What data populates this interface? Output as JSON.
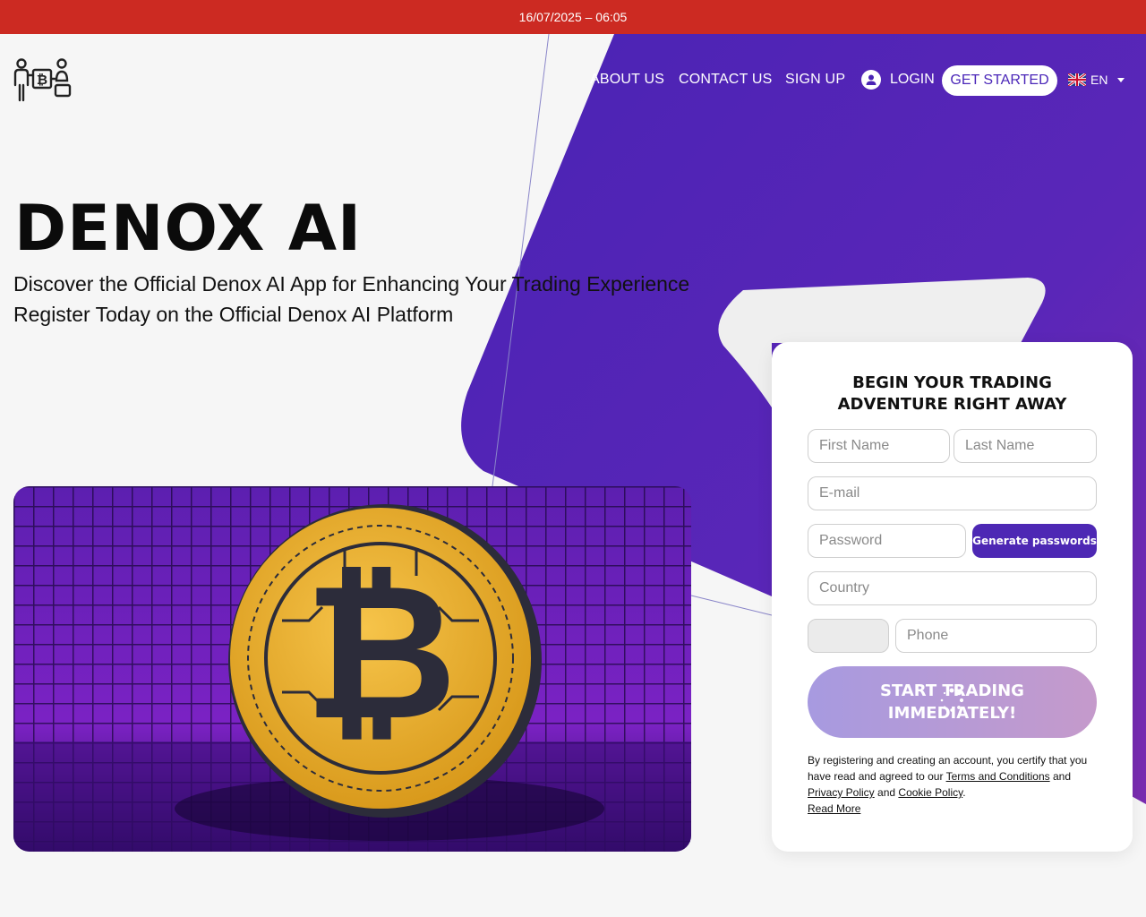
{
  "topbar": {
    "datetime": "16/07/2025 – 06:05"
  },
  "brand": {
    "logo_icon": "bitcoin-people-logo-icon",
    "accent_purple": "#4a23b4",
    "topbar_red": "#cc2a22"
  },
  "nav": {
    "items": [
      {
        "label": "ABOUT US"
      },
      {
        "label": "CONTACT US"
      },
      {
        "label": "SIGN UP"
      }
    ],
    "login": {
      "label": "LOGIN",
      "icon": "user-icon"
    },
    "cta": {
      "label": "GET STARTED"
    },
    "language": {
      "label": "EN",
      "icon": "uk-flag-icon"
    }
  },
  "hero": {
    "title": "DENOX AI",
    "subtitle_line1": "Discover the Official Denox AI App for Enhancing Your Trading Experience",
    "subtitle_line2": "Register Today on the Official Denox AI Platform",
    "image_icon": "bitcoin-coin-icon"
  },
  "form": {
    "title": "BEGIN YOUR TRADING ADVENTURE RIGHT AWAY",
    "first_name_placeholder": "First Name",
    "last_name_placeholder": "Last Name",
    "email_placeholder": "E-mail",
    "password_placeholder": "Password",
    "generate_label": "Generate passwords",
    "country_placeholder": "Country",
    "phone_placeholder": "Phone",
    "submit_line1": "START TRADING",
    "submit_line2": "IMMEDIATELY!",
    "legal": {
      "prefix": "By registering and creating an account, you certify that you have read and agreed to our",
      "terms": "Terms and Conditions",
      "and1": "and",
      "privacy": "Privacy Policy",
      "and2": "and",
      "cookie": "Cookie Policy",
      "period": ".",
      "read_more": "Read More"
    }
  }
}
